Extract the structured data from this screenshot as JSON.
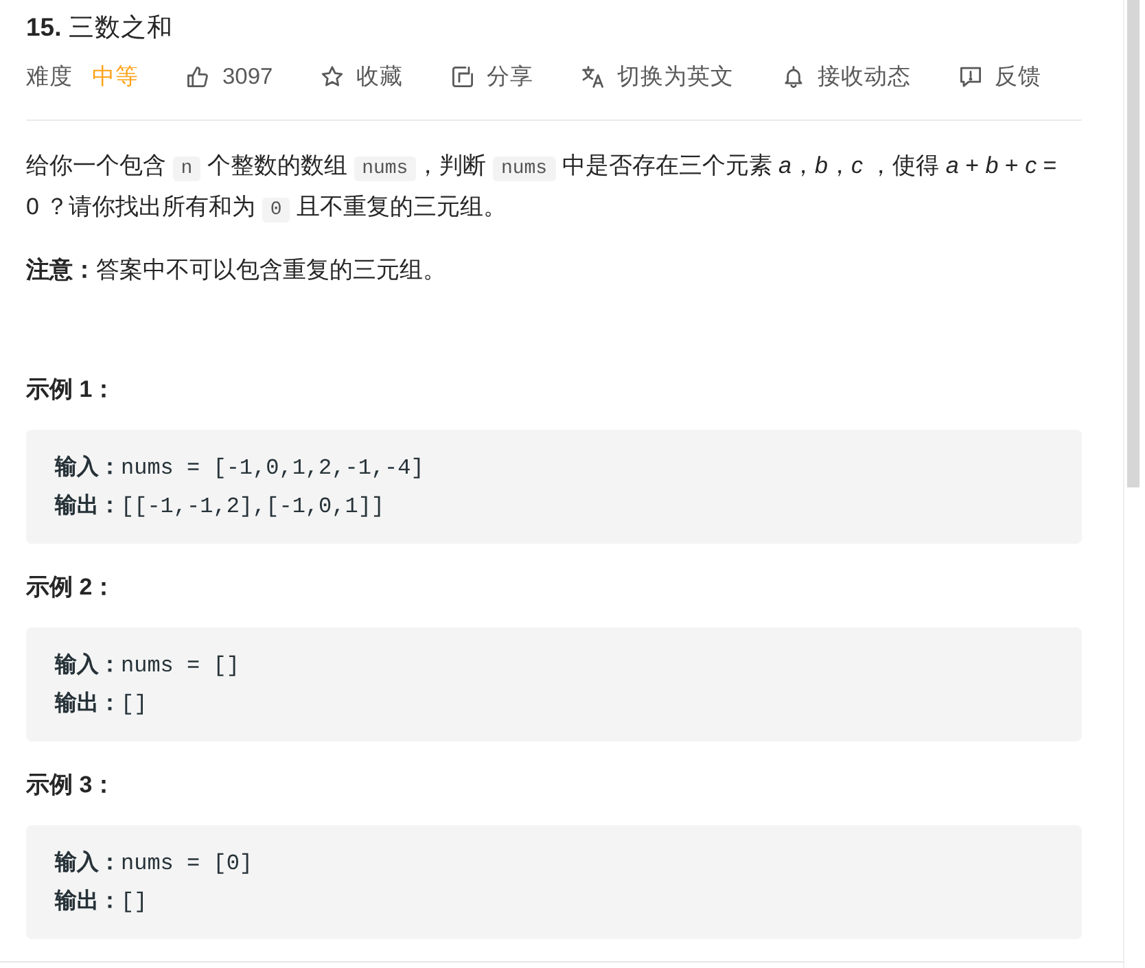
{
  "title": "**15.** 三数之和",
  "toolbar": {
    "difficulty_label": "难度",
    "difficulty": "中等",
    "actions": [
      {
        "kind": "like",
        "label": "3097"
      },
      {
        "kind": "favorite",
        "label": "收藏"
      },
      {
        "kind": "share",
        "label": "分享"
      },
      {
        "kind": "translate",
        "label": "切换为英文"
      },
      {
        "kind": "subscribe",
        "label": "接收动态"
      },
      {
        "kind": "feedback",
        "label": "反馈"
      }
    ]
  },
  "description": {
    "paragraphs": [
      {
        "segments": [
          {
            "kind": "text",
            "text": "给你一个包含 "
          },
          {
            "kind": "code",
            "text": "n"
          },
          {
            "kind": "text",
            "text": " 个整数的数组 "
          },
          {
            "kind": "code",
            "text": "nums"
          },
          {
            "kind": "text",
            "text": "，判断 "
          },
          {
            "kind": "code",
            "text": "nums"
          },
          {
            "kind": "text",
            "text": " 中是否存在三个元素 *a*，*b*，*c* ，使得 *a* + *b* + *c* = 0 ？请你找出所有和为 "
          },
          {
            "kind": "code",
            "text": "0"
          },
          {
            "kind": "text",
            "text": " 且不重复的三元组。"
          }
        ]
      },
      {
        "segments": [
          {
            "kind": "text",
            "text": "**注意：**答案中不可以包含重复的三元组。"
          }
        ]
      }
    ]
  },
  "examples": [
    {
      "heading": "示例 1：",
      "lines": [
        "**输入：**nums = [-1,0,1,2,-1,-4]",
        "**输出：**[[-1,-1,2],[-1,0,1]]"
      ]
    },
    {
      "heading": "示例 2：",
      "lines": [
        "**输入：**nums = []",
        "**输出：**[]"
      ]
    },
    {
      "heading": "示例 3：",
      "lines": [
        "**输入：**nums = [0]",
        "**输出：**[]"
      ]
    }
  ]
}
